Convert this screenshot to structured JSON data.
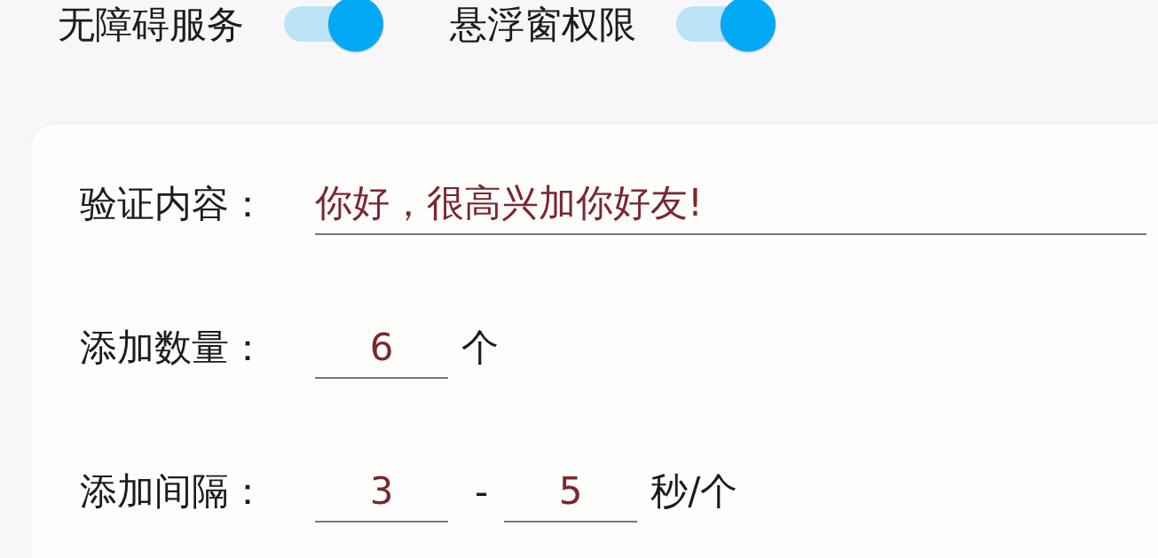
{
  "toggles": [
    {
      "label": "无障碍服务",
      "on": true
    },
    {
      "label": "悬浮窗权限",
      "on": true
    }
  ],
  "form": {
    "rows": [
      {
        "kind": "text",
        "label": "验证内容：",
        "value": "你好，很高兴加你好友!"
      },
      {
        "kind": "number",
        "label": "添加数量：",
        "value": "6",
        "unit": "个"
      },
      {
        "kind": "range",
        "label": "添加间隔：",
        "from": "3",
        "separator": "-",
        "to": "5",
        "unit": "秒/个"
      }
    ]
  }
}
